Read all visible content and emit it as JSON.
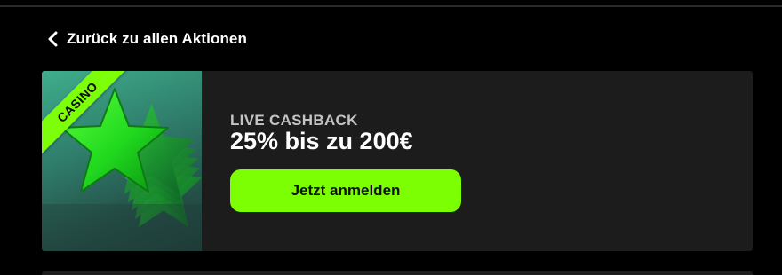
{
  "navigation": {
    "back_label": "Zurück zu allen Aktionen",
    "back_icon": "chevron-left-icon"
  },
  "promo": {
    "badge": "CASINO",
    "subtitle": "LIVE CASHBACK",
    "title": "25% bis zu 200€",
    "cta_label": "Jetzt anmelden",
    "image_icon": "green-star-icon"
  },
  "colors": {
    "background": "#000000",
    "card": "#1c1c1c",
    "accent": "#7cff03",
    "subtitle": "#c4c4c4"
  }
}
